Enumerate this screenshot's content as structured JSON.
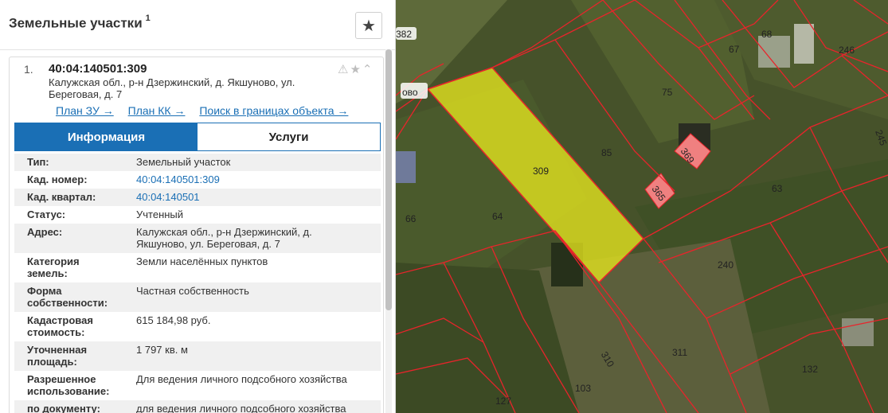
{
  "panel": {
    "title": "Земельные участки",
    "title_sup": "1",
    "favorite_icon": "star-icon"
  },
  "item": {
    "index": "1.",
    "cad_number": "40:04:140501:309",
    "address_line1": "Калужская обл., р-н Дзержинский, д. Якшуново, ул.",
    "address_line2": "Береговая, д. 7",
    "icons": [
      "warning-icon",
      "star-icon",
      "chevron-up-icon"
    ]
  },
  "links": {
    "plan_zu": "План ЗУ →",
    "plan_kk": "План КК →",
    "search": "Поиск в границах объекта →"
  },
  "tabs": {
    "info": "Информация",
    "services": "Услуги"
  },
  "properties": [
    {
      "key": "Тип:",
      "value": "Земельный участок"
    },
    {
      "key": "Кад. номер:",
      "value": "40:04:140501:309"
    },
    {
      "key": "Кад. квартал:",
      "value": "40:04:140501"
    },
    {
      "key": "Статус:",
      "value": "Учтенный"
    },
    {
      "key": "Адрес:",
      "value": "Калужская обл., р-н Дзержинский, д. Якшуново, ул. Береговая, д. 7"
    },
    {
      "key": "Категория земель:",
      "value": "Земли населённых пунктов"
    },
    {
      "key": "Форма собственности:",
      "value": "Частная собственность"
    },
    {
      "key": "Кадастровая стоимость:",
      "value": "615 184,98 руб."
    },
    {
      "key": "Уточненная площадь:",
      "value": "1 797 кв. м"
    },
    {
      "key": "Разрешенное использование:",
      "value": "Для ведения личного подсобного хозяйства"
    },
    {
      "key": "по документу:",
      "value": "для ведения личного подсобного хозяйства"
    }
  ],
  "map": {
    "selected_parcel": "309",
    "parcel_labels": [
      "382",
      "ово",
      "67",
      "68",
      "246",
      "75",
      "245",
      "85",
      "369",
      "365",
      "309",
      "63",
      "66",
      "64",
      "240",
      "310",
      "311",
      "132",
      "103",
      "127"
    ],
    "colors": {
      "parcel_border": "#e8242b",
      "selected_fill": "#e6e61f",
      "small_parcel_fill": "#f08080",
      "link": "#1a6fb5"
    }
  }
}
